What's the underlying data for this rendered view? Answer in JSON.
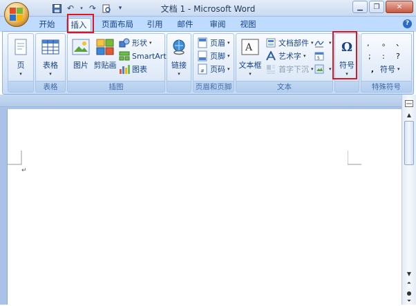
{
  "window": {
    "title": "文档 1 - Microsoft Word"
  },
  "quick_access": {
    "undo_label": "↶",
    "redo_label": "↷",
    "more_label": "▾"
  },
  "tabs": [
    "开始",
    "插入",
    "页面布局",
    "引用",
    "邮件",
    "审阅",
    "视图"
  ],
  "active_tab": "插入",
  "help_label": "?",
  "groups": {
    "pages": {
      "label": "",
      "page_btn": "页"
    },
    "tables": {
      "label": "表格",
      "table_btn": "表格"
    },
    "illustrations": {
      "label": "插图",
      "picture": "图片",
      "clipart": "剪贴画",
      "shapes": "形状",
      "smartart": "SmartArt",
      "chart": "图表"
    },
    "links": {
      "label": "",
      "link_btn": "链接"
    },
    "header_footer": {
      "label": "页眉和页脚",
      "header": "页眉",
      "footer": "页脚",
      "page_number": "页码"
    },
    "text": {
      "label": "文本",
      "textbox": "文本框",
      "quickparts": "文档部件",
      "wordart": "艺术字",
      "dropcap": "首字下沉"
    },
    "symbols": {
      "label": "",
      "symbol_btn": "符号",
      "omega": "Ω"
    },
    "special_symbols": {
      "label": "特殊符号",
      "marks": [
        ",",
        "。",
        "、",
        ";",
        ":",
        "?"
      ],
      "symbol_btn": "符号"
    }
  },
  "document": {
    "paragraph_mark": "↵"
  },
  "colors": {
    "accent": "#15428b",
    "highlight": "#e0141e",
    "ribbon": "#dbe8f9"
  }
}
